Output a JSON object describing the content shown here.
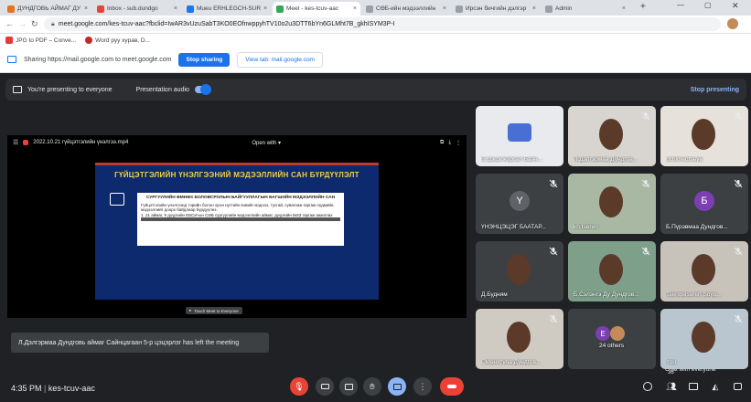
{
  "tabs": [
    {
      "title": "ДУНДГОВЬ АЙМАГ ДУ",
      "color": "#e8711c"
    },
    {
      "title": "Inbox - sub.dundgo",
      "color": "#ea4335"
    },
    {
      "title": "Mueu ERHLEGCH-SUR",
      "color": "#1877f2"
    },
    {
      "title": "Meet - kes-tcuv-aac",
      "color": "#34a853"
    },
    {
      "title": "СӨБ-ийн мэдээллийн",
      "color": "#9aa0a6"
    },
    {
      "title": "Ирсэн бичгийн дэлгэр",
      "color": "#9aa0a6"
    },
    {
      "title": "Admin",
      "color": "#9aa0a6"
    }
  ],
  "address": "meet.google.com/kes-tcuv-aac?fbclid=IwAR3vUzuSabT3KO0EOfnwppyhTV10o2u3DTT6bYn6GLMht7B_gkhISYM3P-I",
  "bookmarks": [
    "JPG to PDF – Conve...",
    "Word руу хурав, D..."
  ],
  "share": {
    "text": "Sharing https://mail.google.com to meet.google.com",
    "stop": "Stop sharing",
    "view": "View tab: mail.google.com"
  },
  "presenting": {
    "label": "You're presenting to everyone",
    "audio": "Presentation audio",
    "stop": "Stop presenting"
  },
  "video": {
    "filename": "2022.10.21 гүйцэтгэлийн үнэлгээ.mp4",
    "openwith": "Open with ▾",
    "slide_title": "ГҮЙЦЭТГЭЛИЙН ҮНЭЛГЭЭНИЙ МЭДЭЭЛЛИЙН САН БҮРДҮҮЛЭЛТ",
    "doc_title": "СУРГУУЛИЙН ӨМНӨХ БОЛОВСРОЛЫН БАЙГУУЛЛАГЫН БАГШИЙН МЭДЭЭЛЛИЙН САН",
    "doc_text": "Гүйцэтгэлийн үнэлгээнд тэрийн болон орон нутгийн вэвийг мэдэээ, тусгай, сувагнаж гаргаж пүдмийн, мэдээллийг доорх байдлаар бүрдүүлнэ.",
    "doc_item": "1. 21 аймаг, 9 дүүргийн ЕБСИ-ын СӨБ сургуулийн мэдээллийн аймаг, дүүргийн БӨЗ гаргаж ажиллах",
    "footer": "Touch Meet to Everyone"
  },
  "toast": "Л.Дэлгэрмаа Дундговь аймаг Сайнцагаан 5-р цэцэрлэг has left the meeting",
  "participants": [
    {
      "name": "Б.Цэцэгжаргал Баян...",
      "kind": "logo",
      "bg": "#e8eaed"
    },
    {
      "name": "Л.Дэлгэрмаа Дундгов...",
      "kind": "photo",
      "bg": "#d8d4cf"
    },
    {
      "name": "ochimedtseye",
      "kind": "photo",
      "bg": "#e6e1da"
    },
    {
      "name": "ҮНЭНЦЭЦЭГ БААТАР...",
      "kind": "avatar",
      "letter": "Y",
      "bg": "#3c4043",
      "color": "#5f6368"
    },
    {
      "name": "kh.tseren",
      "kind": "photo",
      "bg": "#a9b8a3"
    },
    {
      "name": "Б.Пүрэвмаа Дундгов...",
      "kind": "avatar",
      "letter": "Б",
      "bg": "#3c4043",
      "color": "#7b3fb3"
    },
    {
      "name": "Д.Будням",
      "kind": "photo",
      "bg": "#3c4043"
    },
    {
      "name": "Б.Сэлэнгэ Ду Дундгов...",
      "kind": "photo",
      "bg": "#7ea08a"
    },
    {
      "name": "Tsengelsuren Soyo...",
      "kind": "photo",
      "bg": "#c7c2ba"
    },
    {
      "name": "Г.Мөнхтуяа Дундгов...",
      "kind": "photo",
      "bg": "#cfcac2"
    },
    {
      "name": "24 others",
      "kind": "others",
      "letter": "Е",
      "bg": "#3c4043"
    },
    {
      "name": "You",
      "kind": "photo",
      "bg": "#b9c5cf"
    }
  ],
  "bottom": {
    "time": "4:35 PM",
    "code": "kes-tcuv-aac",
    "chat_tooltip": "Chat with everyone",
    "people_count": "36"
  }
}
